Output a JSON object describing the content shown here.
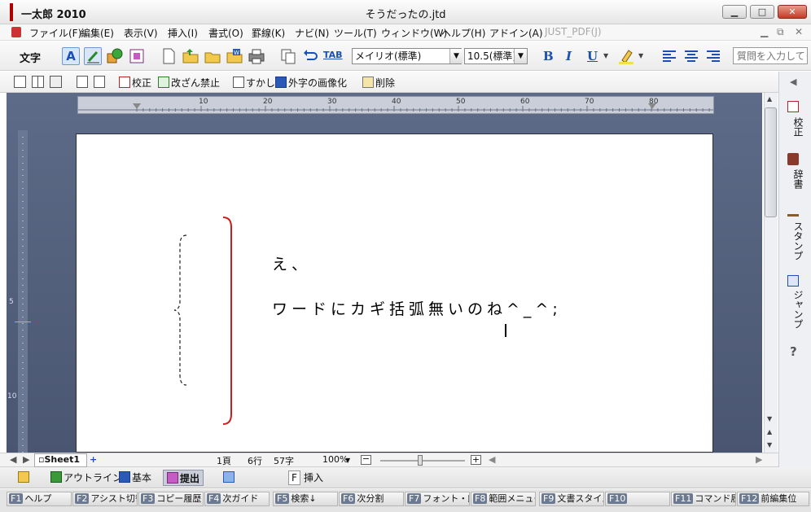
{
  "window": {
    "app_title": "一太郎 2010",
    "doc_title": "そうだったの.jtd",
    "min_label": "▁",
    "max_label": "□",
    "close_label": "✕"
  },
  "menu": [
    "ファイル(F)",
    "編集(E)",
    "表示(V)",
    "挿入(I)",
    "書式(O)",
    "罫線(K)",
    "ナビ(N)",
    "ツール(T)",
    "ウィンドウ(W)",
    "ヘルプ(H)",
    "アドイン(A)",
    "JUST_PDF(J)"
  ],
  "toolbar1": {
    "mode_label": "文字",
    "font_name": "メイリオ(標準)",
    "font_size": "10.5(標準)",
    "bold": "B",
    "italic": "I",
    "underline": "U",
    "tab_label": "TAB",
    "question_placeholder": "質問を入力してく"
  },
  "toolbar2": {
    "proof": "校正",
    "no_modify": "改ざん禁止",
    "watermark": "すかし",
    "gaiji": "外字の画像化",
    "delete": "削除"
  },
  "ruler": {
    "ticks": [
      "10",
      "20",
      "30",
      "40",
      "50",
      "60",
      "70",
      "80"
    ],
    "v_ticks": [
      "5",
      "10"
    ]
  },
  "document": {
    "line1": "え、",
    "line2": "ワードにカギ括弧無いのね^_^;"
  },
  "side_panel": {
    "proof": "校正",
    "dictionary": "辞書",
    "stamp": "スタンプ",
    "jump": "ジャンプ",
    "help": "?"
  },
  "status": {
    "sheet": "Sheet1",
    "page": "1頁",
    "lines": "6行",
    "chars": "57字",
    "zoom": "100%"
  },
  "modes": {
    "outline": "アウトライン",
    "basic": "基本",
    "submit": "提出",
    "insert_key": "F",
    "insert": "挿入"
  },
  "fkeys": [
    {
      "key": "F1",
      "label": "ヘルプ"
    },
    {
      "key": "F2",
      "label": "アシスト切替"
    },
    {
      "key": "F3",
      "label": "コピー履歴"
    },
    {
      "key": "F4",
      "label": "次ガイド"
    },
    {
      "key": "F5",
      "label": "検索↓"
    },
    {
      "key": "F6",
      "label": "次分割"
    },
    {
      "key": "F7",
      "label": "フォント・飾り"
    },
    {
      "key": "F8",
      "label": "範囲メニュー"
    },
    {
      "key": "F9",
      "label": "文書スタイル"
    },
    {
      "key": "F10",
      "label": ""
    },
    {
      "key": "F11",
      "label": "コマンド履歴"
    },
    {
      "key": "F12",
      "label": "前編集位"
    }
  ],
  "colors": {
    "bracket_red": "#c81e1e",
    "workspace": "#56637f"
  }
}
